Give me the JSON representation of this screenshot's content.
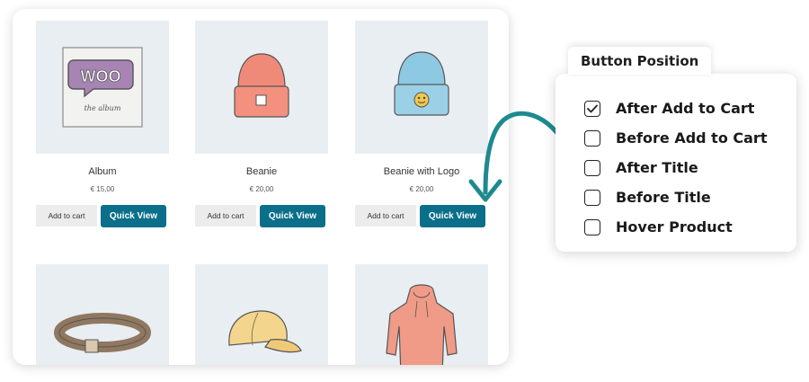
{
  "products": [
    {
      "title": "Album",
      "price": "€ 15,00",
      "add_label": "Add to cart",
      "quick_label": "Quick View"
    },
    {
      "title": "Beanie",
      "price": "€ 20,00",
      "add_label": "Add to cart",
      "quick_label": "Quick View"
    },
    {
      "title": "Beanie with Logo",
      "price": "€ 20,00",
      "add_label": "Add to cart",
      "quick_label": "Quick View"
    },
    {
      "title": "",
      "price": ""
    },
    {
      "title": "",
      "price": ""
    },
    {
      "title": "",
      "price": ""
    }
  ],
  "album_art": {
    "logo": "WOO",
    "caption": "the album"
  },
  "settings": {
    "title": "Button Position",
    "options": [
      {
        "label": "After Add to Cart",
        "checked": true
      },
      {
        "label": "Before Add to Cart",
        "checked": false
      },
      {
        "label": "After Title",
        "checked": false
      },
      {
        "label": "Before Title",
        "checked": false
      },
      {
        "label": "Hover Product",
        "checked": false
      }
    ]
  },
  "colors": {
    "accent": "#0b6f8a",
    "arrow": "#1d8a8f",
    "thumb_bg": "#e9eef2"
  },
  "icons": [
    "checkmark-icon",
    "curved-arrow-icon"
  ]
}
